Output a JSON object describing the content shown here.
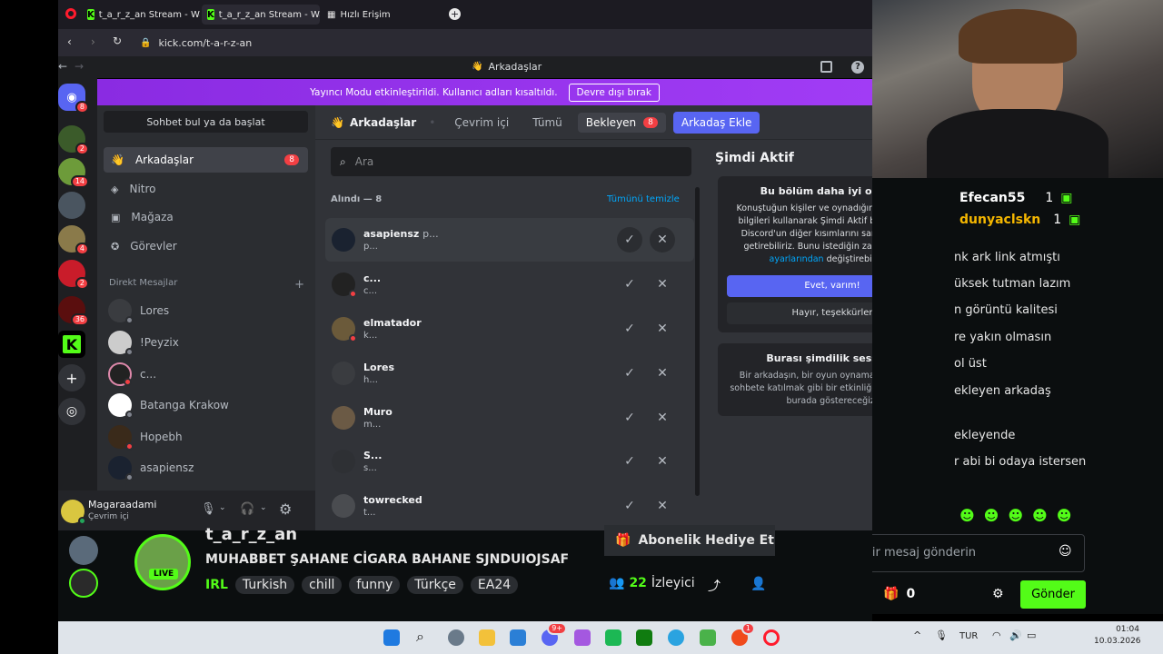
{
  "browser": {
    "tabs": [
      {
        "label": "t_a_r_z_an Stream - Watch"
      },
      {
        "label": "t_a_r_z_an Stream - Watch"
      },
      {
        "label": "Hızlı Erişim"
      }
    ],
    "url": "kick.com/t-a-r-z-an"
  },
  "discord": {
    "window_title": "Arkadaşlar",
    "banner": {
      "text": "Yayıncı Modu etkinleştirildi. Kullanıcı adları kısaltıldı.",
      "button": "Devre dışı bırak"
    },
    "servers": [
      {
        "name": "discord-home",
        "badge": "8"
      },
      {
        "name": "tarzan-server",
        "badge": "2"
      },
      {
        "name": "server-3",
        "badge": "14"
      },
      {
        "name": "server-4",
        "badge": ""
      },
      {
        "name": "server-5",
        "badge": "4"
      },
      {
        "name": "server-6",
        "badge": "2"
      },
      {
        "name": "server-7",
        "badge": "36"
      },
      {
        "name": "kick-server",
        "badge": ""
      }
    ],
    "sidebar": {
      "search_button": "Sohbet bul ya da başlat",
      "nav": [
        {
          "label": "Arkadaşlar",
          "badge": "8"
        },
        {
          "label": "Nitro"
        },
        {
          "label": "Mağaza"
        },
        {
          "label": "Görevler"
        }
      ],
      "dm_header": "Direkt Mesajlar",
      "dms": [
        {
          "name": "Lores",
          "status": "#80848e"
        },
        {
          "name": "!Peyzix",
          "status": "#80848e"
        },
        {
          "name": "c...",
          "status": "#f23f43"
        },
        {
          "name": "Batanga Krakow",
          "status": "#80848e"
        },
        {
          "name": "Hopebh",
          "status": "#f23f43"
        },
        {
          "name": "asapiensz",
          "status": "#80848e"
        }
      ]
    },
    "user": {
      "name": "Magaraadami",
      "status": "Çevrim içi"
    },
    "friends": {
      "title": "Arkadaşlar",
      "tabs": [
        "Çevrim içi",
        "Tümü",
        "Bekleyen"
      ],
      "pending_badge": "8",
      "add_friend": "Arkadaş Ekle",
      "search_placeholder": "Ara",
      "section_label": "Alındı — 8",
      "clear_all": "Tümünü temizle",
      "list": [
        {
          "name": "asapiensz",
          "extra": "p...",
          "sub": "p..."
        },
        {
          "name": "c...",
          "extra": "",
          "sub": "c..."
        },
        {
          "name": "elmatador",
          "extra": "",
          "sub": "k..."
        },
        {
          "name": "Lores",
          "extra": "",
          "sub": "h..."
        },
        {
          "name": "Muro",
          "extra": "",
          "sub": "m..."
        },
        {
          "name": "S...",
          "extra": "",
          "sub": "s..."
        },
        {
          "name": "towrecked",
          "extra": "",
          "sub": "t..."
        }
      ]
    },
    "active_now": {
      "title": "Şimdi Aktif",
      "card_title": "Bu bölüm daha iyi olabilir",
      "card_text": "Konuştuğun kişiler ve oynadığın oyunlar gibi bilgileri kullanarak Şimdi Aktif bölümünü ve Discord'un diğer kısımlarını sana özel hale getirebiliriz. Bunu istediğin zaman",
      "card_link": "gizlilik ayarlarından",
      "card_text_end": "değiştirebilirsin.",
      "yes": "Evet, varım!",
      "no": "Hayır, teşekkürler",
      "quiet_title": "Burası şimdilik sessiz...",
      "quiet_text": "Bir arkadaşın, bir oyun oynamak veya sesli sohbete katılmak gibi bir etkinliğe başladığında burada göstereceğiz!"
    }
  },
  "kick": {
    "chat_users": [
      {
        "name": "Efecan55",
        "color": "#ffffff",
        "count": "1"
      },
      {
        "name": "dunyaclskn",
        "color": "#f5b700",
        "count": "1"
      }
    ],
    "chat_lines": [
      "nk ark link atmıştı",
      "üksek tutman lazım",
      "n görüntü kalitesi",
      "re yakın olmasın",
      "ol üst",
      "ekleyen arkadaş",
      "ekleyende",
      "r abi bi odaya istersen"
    ],
    "channel_name": "t_a_r_z_an",
    "stream_title": "MUHABBET ŞAHANE CİGARA BAHANE SJNDUIOJSAF",
    "category": "IRL",
    "tags": [
      "Turkish",
      "chill",
      "funny",
      "Türkçe",
      "EA24"
    ],
    "live_label": "LIVE",
    "subscribe_gift": "Abonelik Hediye Et",
    "viewers": "22",
    "viewers_label": "İzleyici",
    "message_placeholder": "Bir mesaj gönderin",
    "send": "Gönder",
    "points": "0",
    "accent": "#53fc18"
  },
  "taskbar": {
    "lang": "TUR",
    "time": "01:04",
    "date": "10.03.2026",
    "discord_badge": "9+",
    "brave_badge": "1"
  }
}
